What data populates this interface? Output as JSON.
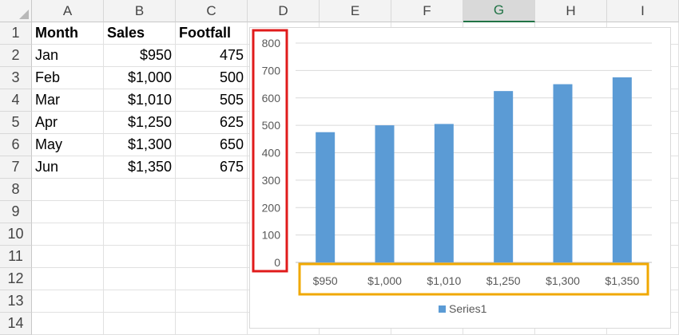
{
  "sheet": {
    "columns": [
      "A",
      "B",
      "C",
      "D",
      "E",
      "F",
      "G",
      "H",
      "I"
    ],
    "selected_column": "G",
    "rows": [
      "1",
      "2",
      "3",
      "4",
      "5",
      "6",
      "7",
      "8",
      "9",
      "10",
      "11",
      "12",
      "13",
      "14"
    ],
    "headers": [
      "Month",
      "Sales",
      "Footfall"
    ],
    "data": [
      [
        "Jan",
        "$950",
        "475"
      ],
      [
        "Feb",
        "$1,000",
        "500"
      ],
      [
        "Mar",
        "$1,010",
        "505"
      ],
      [
        "Apr",
        "$1,250",
        "625"
      ],
      [
        "May",
        "$1,300",
        "650"
      ],
      [
        "Jun",
        "$1,350",
        "675"
      ]
    ]
  },
  "colors": {
    "bar": "#5b9bd5",
    "y_axis_highlight": "#e01b1b",
    "x_axis_highlight": "#f0a800",
    "grid": "#d9d9d9",
    "selected_column": "#217346"
  },
  "chart_data": {
    "type": "bar",
    "categories": [
      "$950",
      "$1,000",
      "$1,010",
      "$1,250",
      "$1,300",
      "$1,350"
    ],
    "series": [
      {
        "name": "Series1",
        "values": [
          475,
          500,
          505,
          625,
          650,
          675
        ]
      }
    ],
    "ylim": [
      0,
      800
    ],
    "yticks": [
      0,
      100,
      200,
      300,
      400,
      500,
      600,
      700,
      800
    ],
    "grid": true,
    "legend": "bottom",
    "y_axis_highlighted": true,
    "x_axis_highlighted": true
  }
}
